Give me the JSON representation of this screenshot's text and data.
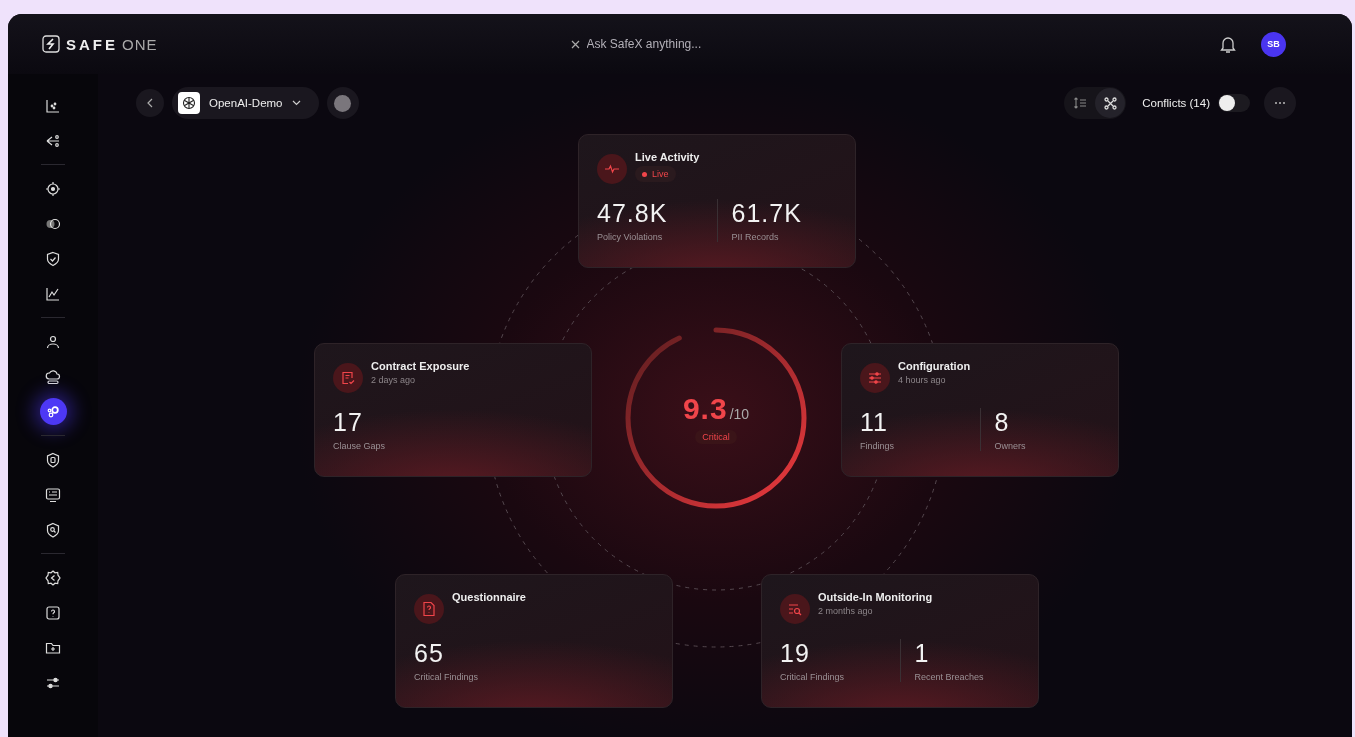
{
  "brand": {
    "name": "SAFE",
    "suffix": "ONE"
  },
  "search": {
    "placeholder": "Ask SafeX anything..."
  },
  "user": {
    "initials": "SB"
  },
  "sidebar": {
    "groups": [
      {
        "items": [
          {
            "selected": false
          },
          {
            "selected": false
          }
        ]
      },
      {
        "items": [
          {
            "selected": false
          },
          {
            "selected": false
          },
          {
            "selected": false
          },
          {
            "selected": false
          }
        ]
      },
      {
        "items": [
          {
            "selected": false
          },
          {
            "selected": false
          },
          {
            "selected": true
          }
        ]
      },
      {
        "items": [
          {
            "selected": false
          },
          {
            "selected": false
          },
          {
            "selected": false
          }
        ]
      },
      {
        "items": [
          {
            "selected": false
          },
          {
            "selected": false
          },
          {
            "selected": false
          },
          {
            "selected": false
          }
        ]
      }
    ]
  },
  "workspace": {
    "name": "OpenAI-Demo"
  },
  "view_buttons": [
    {
      "selected": false
    },
    {
      "selected": true
    }
  ],
  "conflicts": {
    "label": "Conflicts (14)",
    "on": false
  },
  "gauge": {
    "score": "9.3",
    "scale": "/10",
    "status": "Critical",
    "level": 0.93
  },
  "cards": [
    {
      "title": "Live Activity",
      "badge": "Live",
      "metrics": [
        {
          "value": "47.8K",
          "label": "Policy Violations"
        },
        {
          "value": "61.7K",
          "label": "PII Records"
        }
      ]
    },
    {
      "title": "Contract Exposure",
      "subtitle": "2 days ago",
      "metrics": [
        {
          "value": "17",
          "label": "Clause Gaps"
        }
      ]
    },
    {
      "title": "Configuration",
      "subtitle": "4 hours ago",
      "metrics": [
        {
          "value": "11",
          "label": "Findings"
        },
        {
          "value": "8",
          "label": "Owners"
        }
      ]
    },
    {
      "title": "Questionnaire",
      "metrics": [
        {
          "value": "65",
          "label": "Critical Findings"
        }
      ]
    },
    {
      "title": "Outside-In Monitoring",
      "subtitle": "2 months ago",
      "metrics": [
        {
          "value": "19",
          "label": "Critical Findings"
        },
        {
          "value": "1",
          "label": "Recent Breaches"
        }
      ]
    }
  ]
}
